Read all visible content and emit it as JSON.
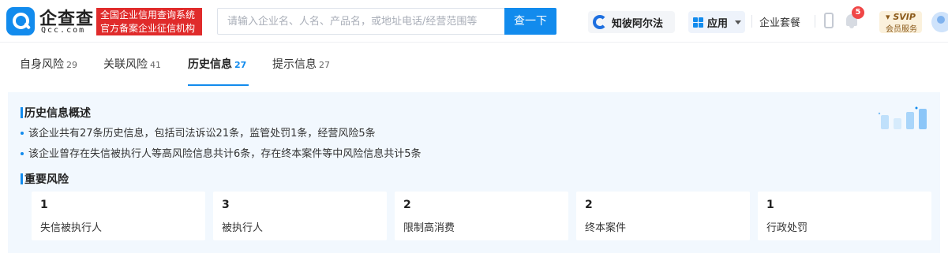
{
  "header": {
    "brand_name": "企查查",
    "brand_domain": "Qcc.com",
    "slogan_line1": "全国企业信用查询系统",
    "slogan_line2": "官方备案企业征信机构",
    "search_placeholder": "请输入企业名、人名、产品名，或地址电话/经营范围等",
    "search_button": "查一下",
    "zhibi_label": "知彼阿尔法",
    "apps_label": "应用",
    "package_label": "企业套餐",
    "notification_count": "5",
    "svip_label": "SVIP",
    "svip_sub": "会员服务"
  },
  "tabs": [
    {
      "label": "自身风险",
      "count": "29"
    },
    {
      "label": "关联风险",
      "count": "41"
    },
    {
      "label": "历史信息",
      "count": "27"
    },
    {
      "label": "提示信息",
      "count": "27"
    }
  ],
  "active_tab": "历史信息",
  "overview": {
    "title": "历史信息概述",
    "bullets": [
      "该企业共有27条历史信息，包括司法诉讼21条，监管处罚1条，经营风险5条",
      "该企业曾存在失信被执行人等高风险信息共计6条，存在终本案件等中风险信息共计5条"
    ]
  },
  "important_risks": {
    "title": "重要风险",
    "cards": [
      {
        "count": "1",
        "label": "失信被执行人"
      },
      {
        "count": "3",
        "label": "被执行人"
      },
      {
        "count": "2",
        "label": "限制高消费"
      },
      {
        "count": "2",
        "label": "终本案件"
      },
      {
        "count": "1",
        "label": "行政处罚"
      }
    ]
  },
  "colors": {
    "primary": "#128bed",
    "slogan_red": "#e02b2b",
    "panel_bg": "#f2f8fe",
    "badge_red": "#f04646"
  }
}
